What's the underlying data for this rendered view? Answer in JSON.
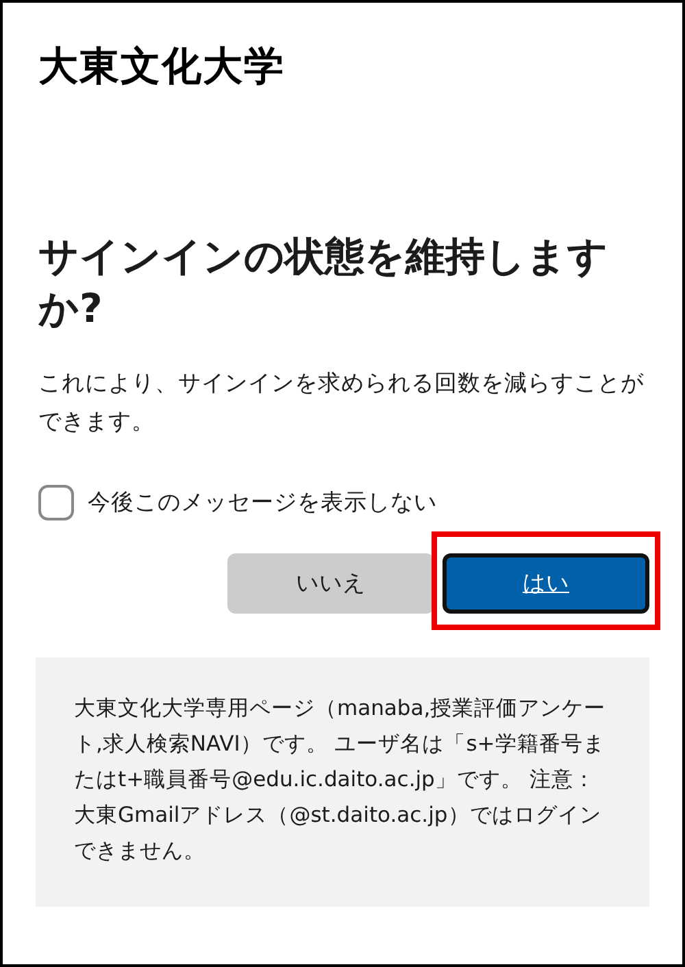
{
  "logo": "大東文化大学",
  "title": "サインインの状態を維持しますか?",
  "description": "これにより、サインインを求められる回数を減らすことができます。",
  "checkbox": {
    "label": "今後このメッセージを表示しない",
    "checked": false
  },
  "buttons": [
    {
      "label": "いいえ",
      "kind": "secondary",
      "highlighted": false
    },
    {
      "label": "はい",
      "kind": "primary",
      "highlighted": true
    }
  ],
  "notice": "大東文化大学専用ページ（manaba,授業評価アンケート,求人検索NAVI）です。 ユーザ名は「s+学籍番号またはt+職員番号@edu.ic.daito.ac.jp」です。 注意：大東Gmailアドレス（@st.daito.ac.jp）ではログインできません。"
}
